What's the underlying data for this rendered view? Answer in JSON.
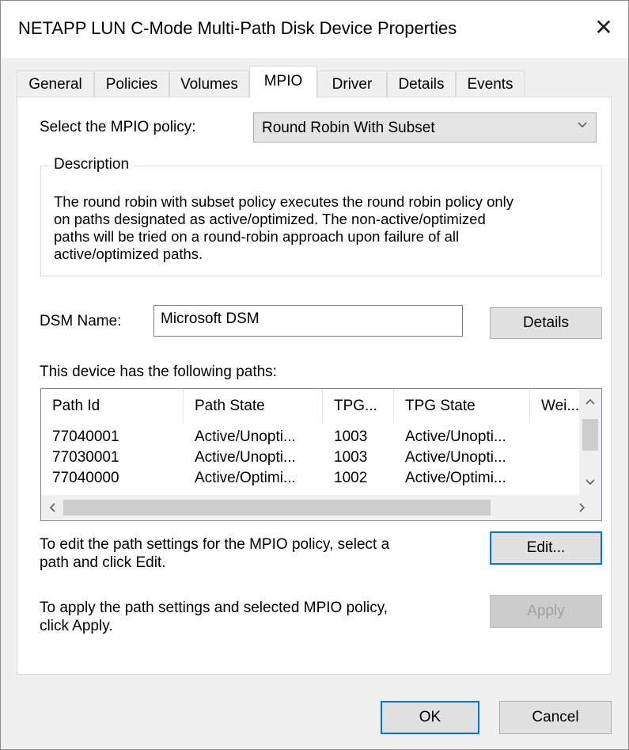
{
  "window": {
    "title": "NETAPP LUN C-Mode  Multi-Path Disk Device Properties",
    "close_glyph": "✕"
  },
  "tabs": [
    {
      "label": "General",
      "active": false
    },
    {
      "label": "Policies",
      "active": false
    },
    {
      "label": "Volumes",
      "active": false
    },
    {
      "label": "MPIO",
      "active": true
    },
    {
      "label": "Driver",
      "active": false
    },
    {
      "label": "Details",
      "active": false
    },
    {
      "label": "Events",
      "active": false
    }
  ],
  "mpio": {
    "policy_label": "Select the MPIO policy:",
    "policy_value": "Round Robin With Subset",
    "description_legend": "Description",
    "description_lines": [
      "The round robin with subset policy executes the round robin policy only",
      "on paths designated as active/optimized.  The non-active/optimized",
      "paths will be tried on a round-robin approach upon failure of all",
      "active/optimized paths."
    ],
    "dsm_label": "DSM Name:",
    "dsm_value": "Microsoft DSM",
    "details_button": "Details",
    "paths_label": "This device has the following paths:",
    "columns": [
      "Path Id",
      "Path State",
      "TPG...",
      "TPG State",
      "Wei..."
    ],
    "rows": [
      [
        "77040001",
        "Active/Unopti...",
        "1003",
        "Active/Unopti...",
        ""
      ],
      [
        "77030001",
        "Active/Unopti...",
        "1003",
        "Active/Unopti...",
        ""
      ],
      [
        "77040000",
        "Active/Optimi...",
        "1002",
        "Active/Optimi...",
        ""
      ]
    ],
    "edit_hint_lines": [
      "To edit the path settings for the MPIO policy, select a",
      "path and click Edit."
    ],
    "edit_button": "Edit...",
    "apply_hint_lines": [
      "To apply the path settings and selected MPIO policy,",
      "click Apply."
    ],
    "apply_button": "Apply"
  },
  "footer": {
    "ok_button": "OK",
    "cancel_button": "Cancel"
  },
  "colors": {
    "focus_border": "#0078d7",
    "dialog_background": "#f0f0f0",
    "disabled_text": "#a0a0a0"
  }
}
